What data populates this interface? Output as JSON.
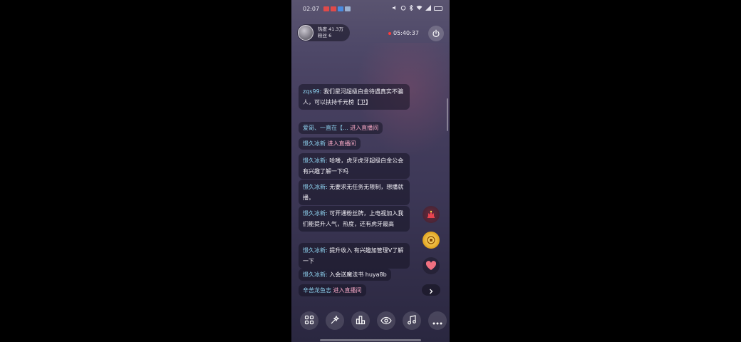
{
  "status_bar": {
    "time": "02:07",
    "notification_colors": [
      "#e04a4a",
      "#e04a4a",
      "#4a8be0",
      "#9ab0d0"
    ],
    "right_icons": [
      "mute-icon",
      "alarm-icon",
      "bluetooth-icon",
      "wifi-icon",
      "signal-icon",
      "battery-icon"
    ]
  },
  "streamer": {
    "line1": "热度 41.3万",
    "line2": "粉丝 6"
  },
  "live": {
    "timer": "05:40:37",
    "accent": "#ff3b3b"
  },
  "chat": {
    "messages": [
      {
        "user": "zqs99:",
        "text": "我们星河超级白金待遇真实不骗人，可以扶持千元榜【卫】",
        "type": "msg"
      },
      {
        "user": "爱哥、一直在【...",
        "text": "进入直播间",
        "type": "enter"
      },
      {
        "user": "憬久冰新",
        "text": "进入直播间",
        "type": "enter"
      },
      {
        "user": "憬久冰新:",
        "text": "哈喽，虎牙虎牙超级白金公会有兴趣了解一下吗",
        "type": "msg"
      },
      {
        "user": "憬久冰新:",
        "text": "无要求无任务无限制，想播就播，",
        "type": "msg"
      },
      {
        "user": "憬久冰新:",
        "text": "可开通粉丝牌，上电视加入我们能提升人气，热度，还有虎牙最高",
        "type": "msg"
      },
      {
        "user": "憬久冰新:",
        "text": "提升收入 有兴趣加管理V了解一下",
        "type": "msg"
      },
      {
        "user": "憬久冰新:",
        "text": "入会送魔法书 huya8b",
        "type": "msg"
      },
      {
        "user": "辛苦龙鱼志",
        "text": "进入直播间",
        "type": "enter"
      }
    ]
  },
  "side_icons": [
    "throne-gift-icon",
    "medal-gift-icon",
    "heart-gift-icon",
    "chevron-right-icon"
  ],
  "toolbar": [
    "apps-icon",
    "magic-wand-icon",
    "ranking-icon",
    "eye-icon",
    "music-icon",
    "more-icon"
  ],
  "colors": {
    "username": "#8fd3f0",
    "enter_text": "#f4a7c4"
  }
}
